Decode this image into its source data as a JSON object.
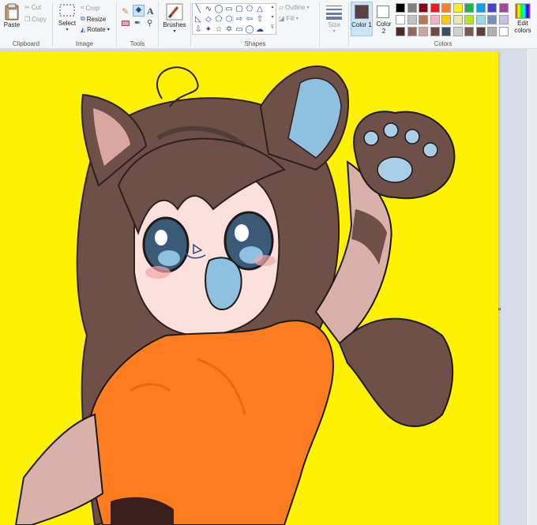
{
  "ribbon": {
    "clipboard": {
      "label": "Clipboard",
      "paste": "Paste",
      "cut": "Cut",
      "copy": "Copy"
    },
    "image": {
      "label": "Image",
      "select": "Select",
      "crop": "Crop",
      "resize": "Resize",
      "rotate": "Rotate"
    },
    "tools": {
      "label": "Tools"
    },
    "brushes": {
      "label": "Brushes"
    },
    "shapes": {
      "label": "Shapes",
      "outline": "Outline",
      "fill": "Fill"
    },
    "size": {
      "label": "Size"
    },
    "colors": {
      "label": "Colors",
      "color1_label": "Color 1",
      "color2_label": "Color 2",
      "edit_colors": "Edit colors",
      "color1_value": "#5a3f44",
      "color2_value": "#ffffff",
      "palette_row1": [
        "#000000",
        "#7f7f7f",
        "#880015",
        "#ed1c24",
        "#ff7f27",
        "#fff200",
        "#22b14c",
        "#00a2e8",
        "#3f48cc",
        "#a349a4"
      ],
      "palette_row2": [
        "#ffffff",
        "#c3c3c3",
        "#b97a57",
        "#ffaec9",
        "#ffc90e",
        "#efe4b0",
        "#b5e61d",
        "#99d9ea",
        "#7092be",
        "#c8bfe7"
      ],
      "palette_row3": [
        "#4a2a28",
        "#8f6862",
        "#c9a6a0",
        "#6d4b44",
        "#3a4f66",
        "#d1d1d1",
        "#7a5a55",
        "#5b3e3a",
        "#b0b0b0",
        "#ffffff"
      ]
    }
  },
  "canvas": {
    "background": "#fff200"
  }
}
